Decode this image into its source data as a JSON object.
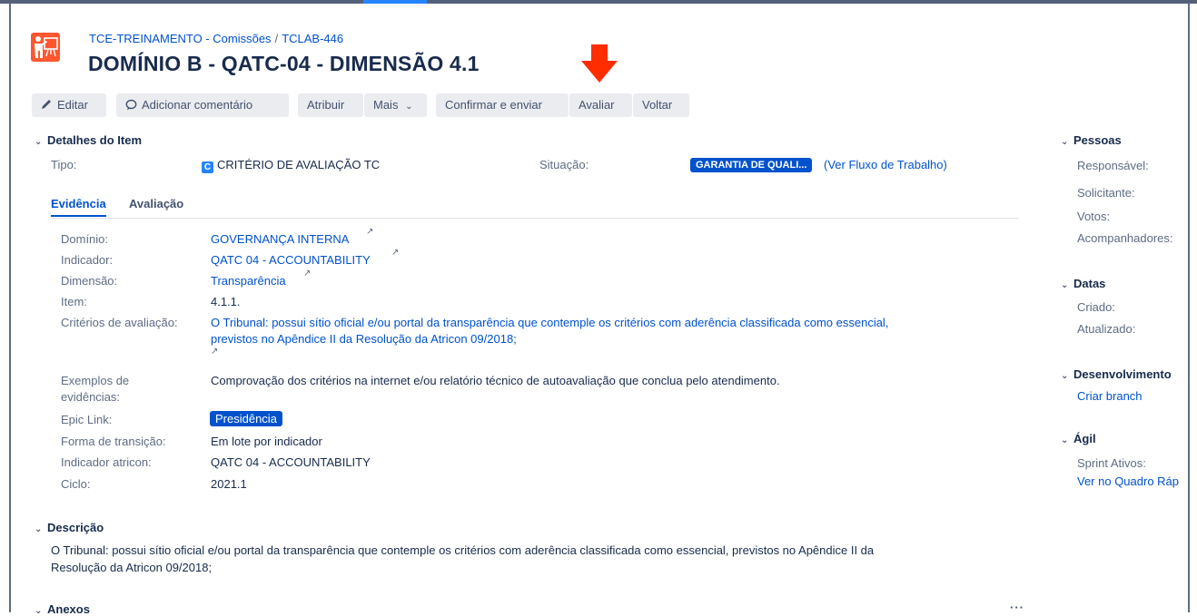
{
  "breadcrumb": {
    "project": "TCE-TREINAMENTO - Comissões",
    "separator": "/",
    "issue_key": "TCLAB-446"
  },
  "issue_title": "DOMÍNIO B - QATC-04 - DIMENSÃO 4.1",
  "toolbar": {
    "edit": "Editar",
    "comment": "Adicionar comentário",
    "assign": "Atribuir",
    "more": "Mais",
    "confirm": "Confirmar e enviar",
    "evaluate": "Avaliar",
    "back": "Voltar"
  },
  "details": {
    "header": "Detalhes do Item",
    "type_label": "Tipo:",
    "type_icon_letter": "C",
    "type_value": "CRITÉRIO DE AVALIAÇÃO TC",
    "status_label": "Situação:",
    "status_value": "GARANTIA DE QUALI...",
    "workflow_link": "(Ver Fluxo de Trabalho)"
  },
  "tabs": [
    "Evidência",
    "Avaliação"
  ],
  "fields": {
    "dominio_label": "Domínio:",
    "dominio_value": "GOVERNANÇA INTERNA",
    "indicador_label": "Indicador:",
    "indicador_value": "QATC 04 - ACCOUNTABILITY",
    "dimensao_label": "Dimensão:",
    "dimensao_value": "Transparência",
    "item_label": "Item:",
    "item_value": "4.1.1.",
    "criterios_label": "Critérios de avaliação:",
    "criterios_line1": "O Tribunal: possui sítio oficial e/ou portal da transparência que contemple os critérios com aderência classificada como essencial,",
    "criterios_line2": "previstos no Apêndice II da Resolução da Atricon 09/2018;",
    "exemplos_label1": "Exemplos de",
    "exemplos_label2": "evidências:",
    "exemplos_value": "Comprovação dos critérios na internet e/ou relatório técnico de autoavaliação que conclua pelo atendimento.",
    "epic_label": "Epic Link:",
    "epic_value": "Presidência",
    "forma_label": "Forma de transição:",
    "forma_value": "Em lote por indicador",
    "indatr_label": "Indicador atricon:",
    "indatr_value": "QATC 04 - ACCOUNTABILITY",
    "ciclo_label": "Ciclo:",
    "ciclo_value": "2021.1"
  },
  "description": {
    "header": "Descrição",
    "line1": "O Tribunal: possui sítio oficial e/ou portal da transparência que contemple os critérios com aderência classificada como essencial, previstos no Apêndice II da",
    "line2": "Resolução da Atricon 09/2018;"
  },
  "attachments": {
    "header": "Anexos",
    "more": "···"
  },
  "sidebar": {
    "people_header": "Pessoas",
    "responsavel": "Responsável:",
    "solicitante": "Solicitante:",
    "votos": "Votos:",
    "acompanhadores": "Acompanhadores:",
    "dates_header": "Datas",
    "criado": "Criado:",
    "atualizado": "Atualizado:",
    "dev_header": "Desenvolvimento",
    "create_branch": "Criar branch",
    "agile_header": "Ágil",
    "sprint_ativos": "Sprint Ativos:",
    "board_link": "Ver no Quadro Ráp"
  },
  "colors": {
    "accent": "#0052cc",
    "arrow": "#ff2d00",
    "project_icon": "#ff5630"
  },
  "icons": {
    "project": "presentation-board-icon",
    "edit": "pencil-icon",
    "comment": "speech-bubble-icon",
    "external": "external-link-icon"
  }
}
